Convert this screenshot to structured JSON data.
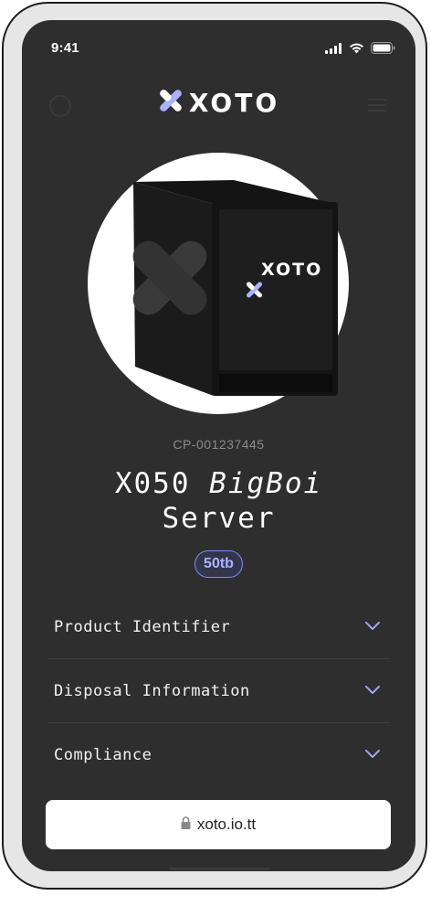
{
  "status_bar": {
    "time": "9:41"
  },
  "brand": {
    "name": "XOTO",
    "accent": "#aab2ff"
  },
  "product": {
    "sku": "CP-001237445",
    "title_line1_regular": "X050 ",
    "title_line1_italic": "BigBoi",
    "title_line2": "Server",
    "capacity_badge": "50tb",
    "device_logo": "XOTO"
  },
  "accordion": [
    {
      "label": "Product Identifier",
      "icon": "chevron-down-icon"
    },
    {
      "label": "Disposal Information",
      "icon": "chevron-down-icon"
    },
    {
      "label": "Compliance",
      "icon": "chevron-down-icon"
    }
  ],
  "browser": {
    "url": "xoto.io.tt",
    "icon": "lock-icon"
  },
  "colors": {
    "screen_bg": "#2e2e2e",
    "badge_border": "#7e89ff",
    "chevron": "#9ba3f5"
  }
}
